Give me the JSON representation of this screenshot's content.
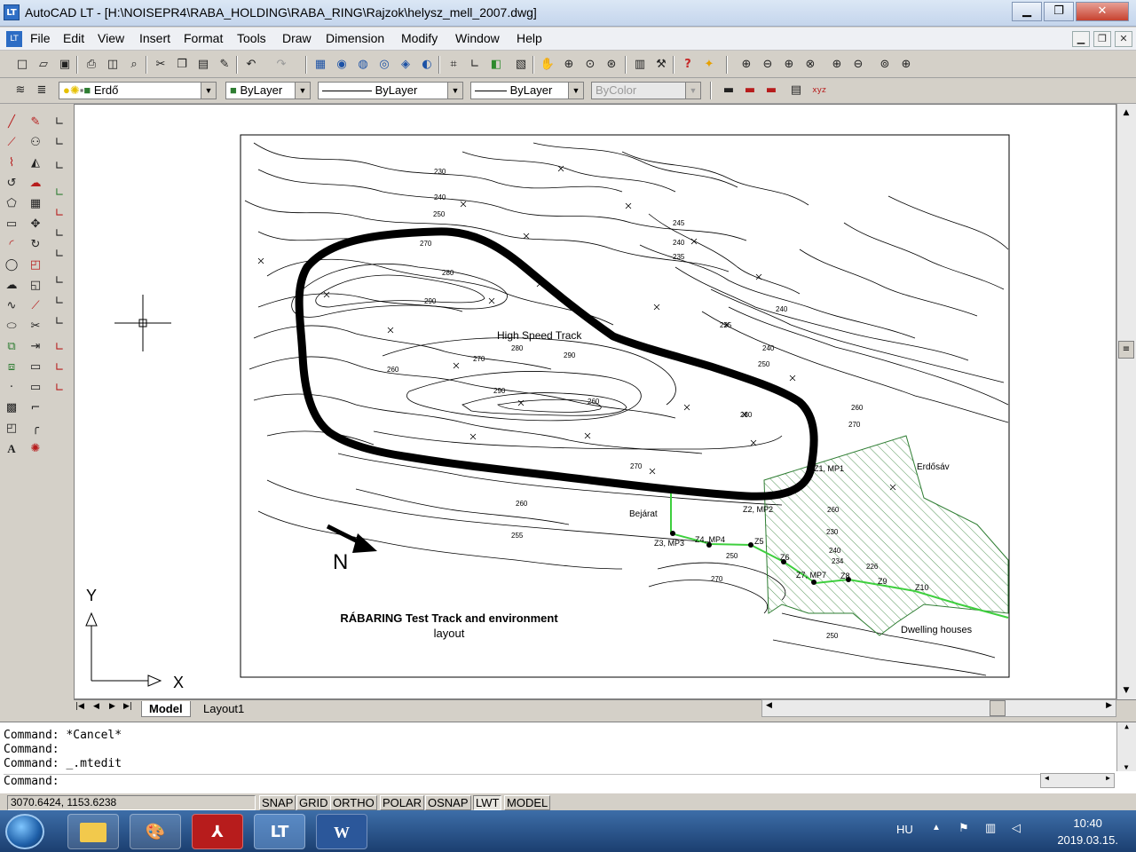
{
  "window": {
    "title": "AutoCAD LT - [H:\\NOISEPR4\\RABA_HOLDING\\RABA_RING\\Rajzok\\helysz_mell_2007.dwg]",
    "app_icon": "LT",
    "min": "▁",
    "max": "❐",
    "close": "✕"
  },
  "menu": {
    "items": [
      "File",
      "Edit",
      "View",
      "Insert",
      "Format",
      "Tools",
      "Draw",
      "Dimension",
      "Modify",
      "Window",
      "Help"
    ],
    "doc_min": "▁",
    "doc_restore": "❐",
    "doc_close": "✕"
  },
  "properties": {
    "layer": "Erdő",
    "color": "ByLayer",
    "linetype": "ByLayer",
    "lineweight": "ByLayer",
    "plotstyle": "ByColor"
  },
  "drawing": {
    "title_line1": "RÁBARING Test Track and environment",
    "title_line2": "layout",
    "north": "N",
    "ucs_y": "Y",
    "ucs_x": "X",
    "labels": {
      "high_speed": "High Speed Track",
      "bejarat": "Bejárat",
      "erdosav": "Erdősáv",
      "dwelling": "Dwelling houses",
      "z1": "Z1, MP1",
      "z2": "Z2, MP2",
      "z3": "Z3, MP3",
      "z4": "Z4, MP4",
      "z5": "Z5",
      "z6": "Z6",
      "z7": "Z7, MP7",
      "z8": "Z8",
      "z9": "Z9",
      "z10": "Z10"
    },
    "contour_labels": [
      "230",
      "240",
      "250",
      "270",
      "280",
      "290",
      "245",
      "240",
      "235",
      "235",
      "240",
      "240",
      "250",
      "260",
      "270",
      "280",
      "290",
      "260",
      "260",
      "270",
      "280",
      "290",
      "270",
      "260",
      "255",
      "270",
      "250",
      "260",
      "230",
      "240",
      "234",
      "226",
      "250"
    ]
  },
  "tabs": {
    "model": "Model",
    "layout1": "Layout1"
  },
  "command": {
    "lines": [
      "Command: *Cancel*",
      "Command:",
      "Command: _.mtedit"
    ],
    "prompt": "Command:"
  },
  "status": {
    "coords": "3070.6424, 1153.6238",
    "buttons": [
      "SNAP",
      "GRID",
      "ORTHO",
      "POLAR",
      "OSNAP",
      "LWT",
      "MODEL"
    ]
  },
  "taskbar": {
    "lang": "HU",
    "time": "10:40",
    "date": "2019.03.15."
  },
  "icons": {
    "contour_color": "#000000",
    "hatch_color": "#2e7d32",
    "route_color": "#3ecf3e"
  }
}
